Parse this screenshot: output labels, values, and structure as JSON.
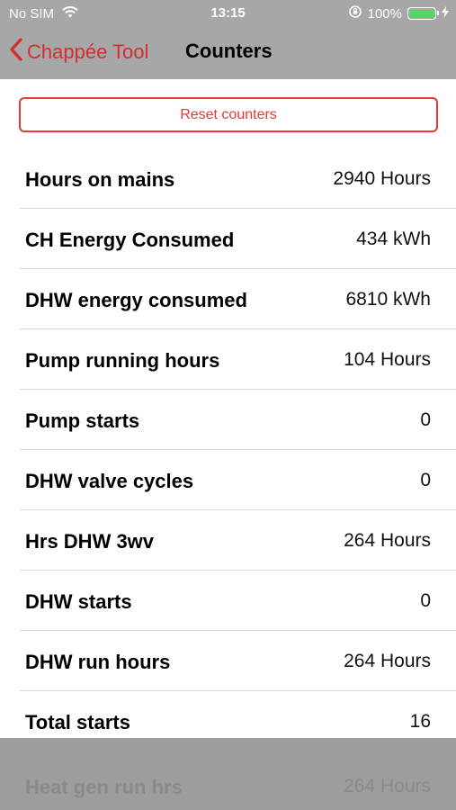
{
  "status": {
    "carrier": "No SIM",
    "time": "13:15",
    "battery": "100%",
    "battery_level": 1.0,
    "battery_color": "#4cd964"
  },
  "nav": {
    "back_label": "Chappée Tool",
    "title": "Counters",
    "accent": "#d32f2f"
  },
  "reset_label": "Reset counters",
  "counters": [
    {
      "label": "Hours on mains",
      "value": "2940 Hours"
    },
    {
      "label": "CH Energy Consumed",
      "value": "434 kWh"
    },
    {
      "label": "DHW energy consumed",
      "value": "6810 kWh"
    },
    {
      "label": "Pump running hours",
      "value": "104 Hours"
    },
    {
      "label": "Pump starts",
      "value": "0"
    },
    {
      "label": "DHW valve cycles",
      "value": "0"
    },
    {
      "label": "Hrs DHW 3wv",
      "value": "264 Hours"
    },
    {
      "label": "DHW starts",
      "value": "0"
    },
    {
      "label": "DHW run hours",
      "value": "264 Hours"
    },
    {
      "label": "Total starts",
      "value": "16"
    }
  ],
  "overlay_row": {
    "label": "Heat gen run hrs",
    "value": "264 Hours"
  },
  "icons": {
    "wifi": "wifi-icon",
    "orientation_lock": "orientation-lock-icon",
    "battery": "battery-icon",
    "charging": "charging-bolt-icon",
    "back": "chevron-left-icon"
  }
}
